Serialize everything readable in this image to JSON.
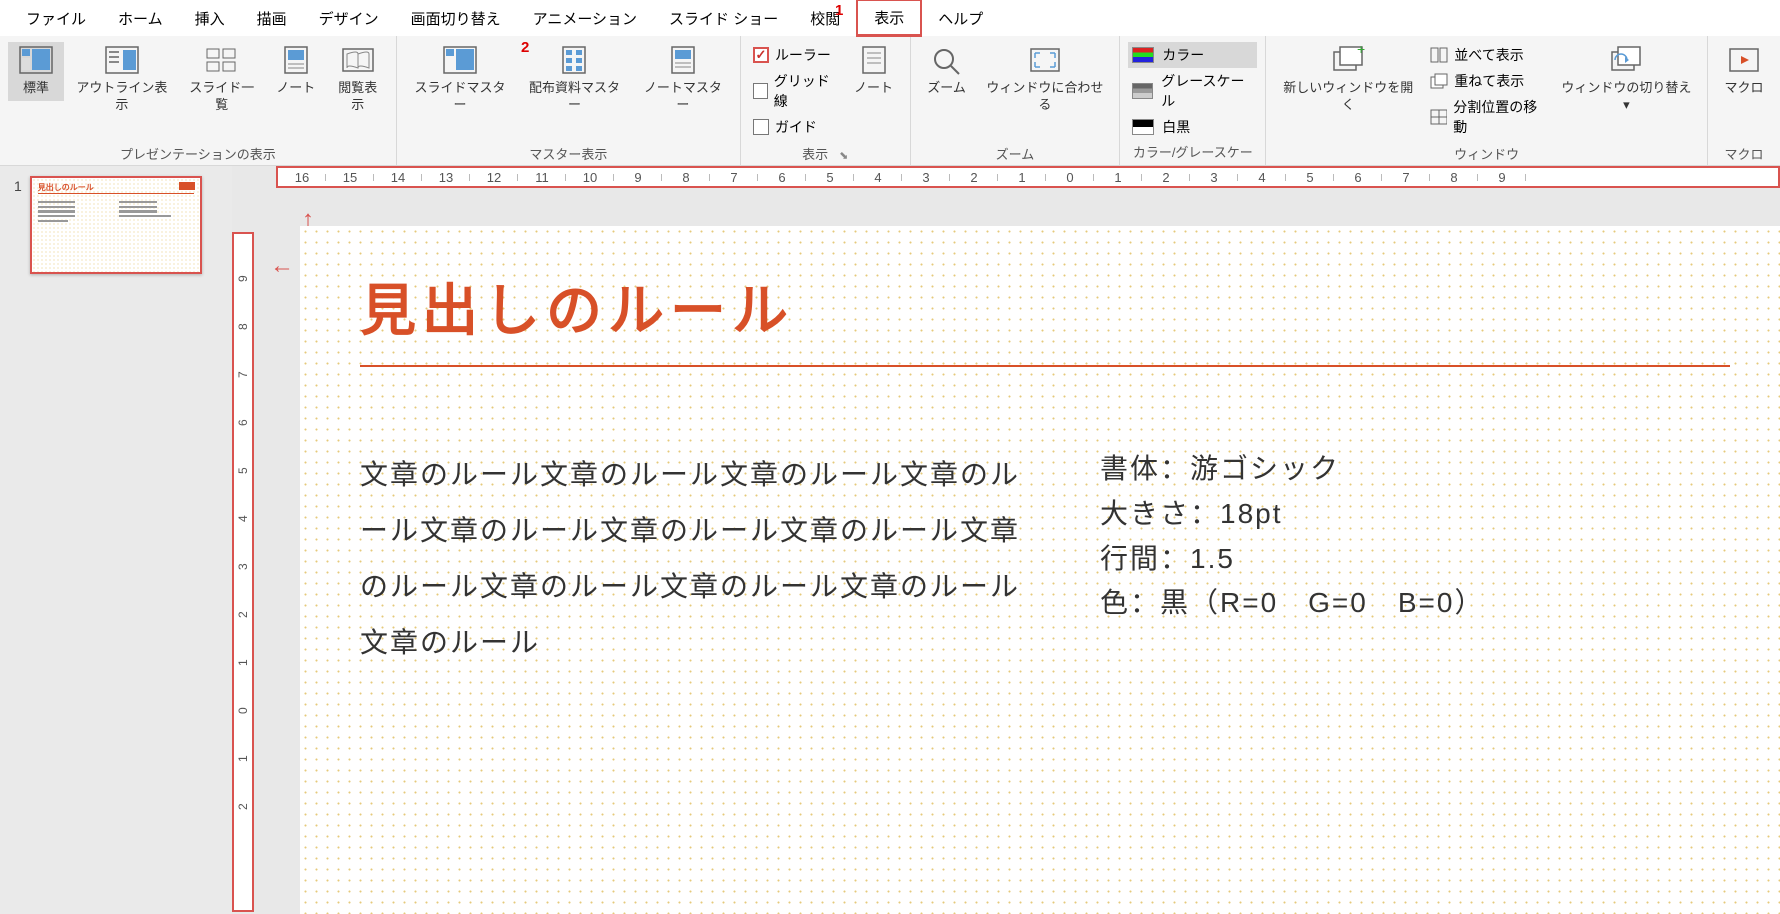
{
  "menu": [
    "ファイル",
    "ホーム",
    "挿入",
    "描画",
    "デザイン",
    "画面切り替え",
    "アニメーション",
    "スライド ショー",
    "校閲",
    "表示",
    "ヘルプ"
  ],
  "menu_active": 9,
  "callouts": {
    "one": "1",
    "two": "2"
  },
  "ribbon": {
    "presentation_views": {
      "label": "プレゼンテーションの表示",
      "normal": "標準",
      "outline": "アウトライン表示",
      "sorter": "スライド一覧",
      "notes": "ノート",
      "reading": "閲覧表示"
    },
    "master_views": {
      "label": "マスター表示",
      "slide": "スライドマスター",
      "handout": "配布資料マスター",
      "notes": "ノートマスター"
    },
    "show": {
      "label": "表示",
      "ruler": "ルーラー",
      "grid": "グリッド線",
      "guide": "ガイド",
      "notes_btn": "ノート"
    },
    "zoom": {
      "label": "ズーム",
      "zoom": "ズーム",
      "fit": "ウィンドウに合わせる"
    },
    "color": {
      "label": "カラー/グレースケール",
      "color": "カラー",
      "gray": "グレースケール",
      "bw": "白黒"
    },
    "window": {
      "label": "ウィンドウ",
      "new": "新しいウィンドウを開く",
      "arrange": "並べて表示",
      "cascade": "重ねて表示",
      "split": "分割位置の移動",
      "switch": "ウィンドウの切り替え"
    },
    "macro": {
      "label": "マクロ",
      "macro": "マクロ"
    }
  },
  "ruler_h": [
    "16",
    "15",
    "14",
    "13",
    "12",
    "11",
    "10",
    "9",
    "8",
    "7",
    "6",
    "5",
    "4",
    "3",
    "2",
    "1",
    "0",
    "1",
    "2",
    "3",
    "4",
    "5",
    "6",
    "7",
    "8",
    "9"
  ],
  "ruler_v": [
    "9",
    "8",
    "7",
    "6",
    "5",
    "4",
    "3",
    "2",
    "1",
    "0",
    "1",
    "2"
  ],
  "thumb": {
    "num": "1",
    "title": "見出しのルール"
  },
  "slide": {
    "title": "見出しのルール",
    "body": "文章のルール文章のルール文章のルール文章のルール文章のルール文章のルール文章のルール文章のルール文章のルール文章のルール文章のルール文章のルール",
    "spec1": "書体：游ゴシック",
    "spec2": "大きさ：18pt",
    "spec3": "行間：1.5",
    "spec4": "色：黒（R=0　G=0　B=0）"
  }
}
